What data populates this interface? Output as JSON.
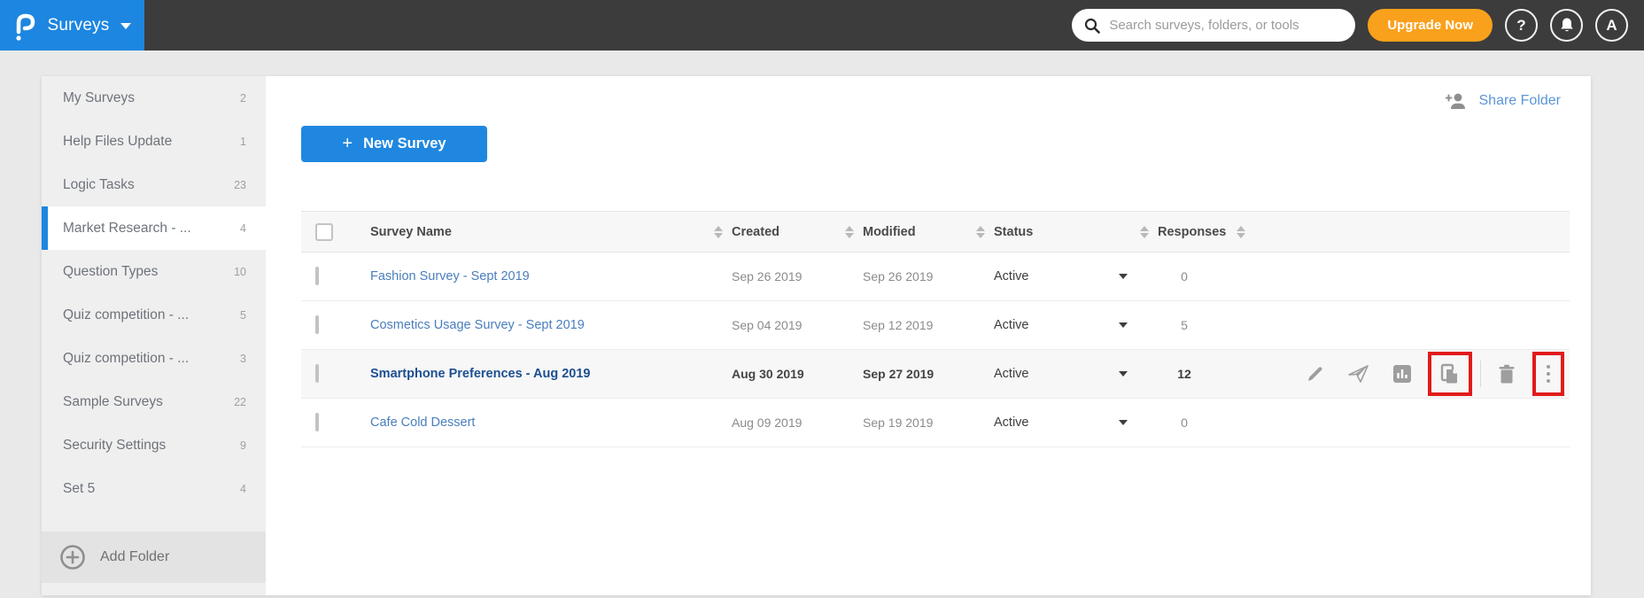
{
  "header": {
    "product": "Surveys",
    "search_placeholder": "Search surveys, folders, or tools",
    "upgrade_label": "Upgrade Now",
    "help_glyph": "?",
    "avatar_initial": "A"
  },
  "sidebar": {
    "items": [
      {
        "label": "My Surveys",
        "count": "2"
      },
      {
        "label": "Help Files Update",
        "count": "1"
      },
      {
        "label": "Logic Tasks",
        "count": "23"
      },
      {
        "label": "Market Research - ...",
        "count": "4"
      },
      {
        "label": "Question Types",
        "count": "10"
      },
      {
        "label": "Quiz competition - ...",
        "count": "5"
      },
      {
        "label": "Quiz competition - ...",
        "count": "3"
      },
      {
        "label": "Sample Surveys",
        "count": "22"
      },
      {
        "label": "Security Settings",
        "count": "9"
      },
      {
        "label": "Set 5",
        "count": "4"
      }
    ],
    "selected_label": "Market Research - ...",
    "add_folder_label": "Add Folder"
  },
  "main": {
    "new_survey_label": "New Survey",
    "new_survey_plus": "+",
    "share_folder_label": "Share Folder",
    "table": {
      "columns": [
        "Survey Name",
        "Created",
        "Modified",
        "Status",
        "Responses"
      ],
      "rows": [
        {
          "name": "Fashion Survey - Sept 2019",
          "created": "Sep 26 2019",
          "modified": "Sep 26 2019",
          "status": "Active",
          "responses": "0"
        },
        {
          "name": "Cosmetics Usage Survey - Sept 2019",
          "created": "Sep 04 2019",
          "modified": "Sep 12 2019",
          "status": "Active",
          "responses": "5"
        },
        {
          "name": "Smartphone Preferences - Aug 2019",
          "created": "Aug 30 2019",
          "modified": "Sep 27 2019",
          "status": "Active",
          "responses": "12",
          "highlighted": true,
          "actions": [
            "edit",
            "send",
            "reports",
            "duplicate",
            "delete",
            "more"
          ],
          "red_callouts": [
            "duplicate",
            "more"
          ]
        },
        {
          "name": "Cafe Cold Dessert",
          "created": "Aug 09 2019",
          "modified": "Sep 19 2019",
          "status": "Active",
          "responses": "0"
        }
      ]
    }
  },
  "colors": {
    "brand_blue": "#1d86e0",
    "topbar_dark": "#3d3c3c",
    "upgrade_orange": "#f9a11c",
    "link_blue": "#4a7ebd",
    "callout_red": "#e11b1b",
    "sidebar_gray": "#efefef"
  }
}
